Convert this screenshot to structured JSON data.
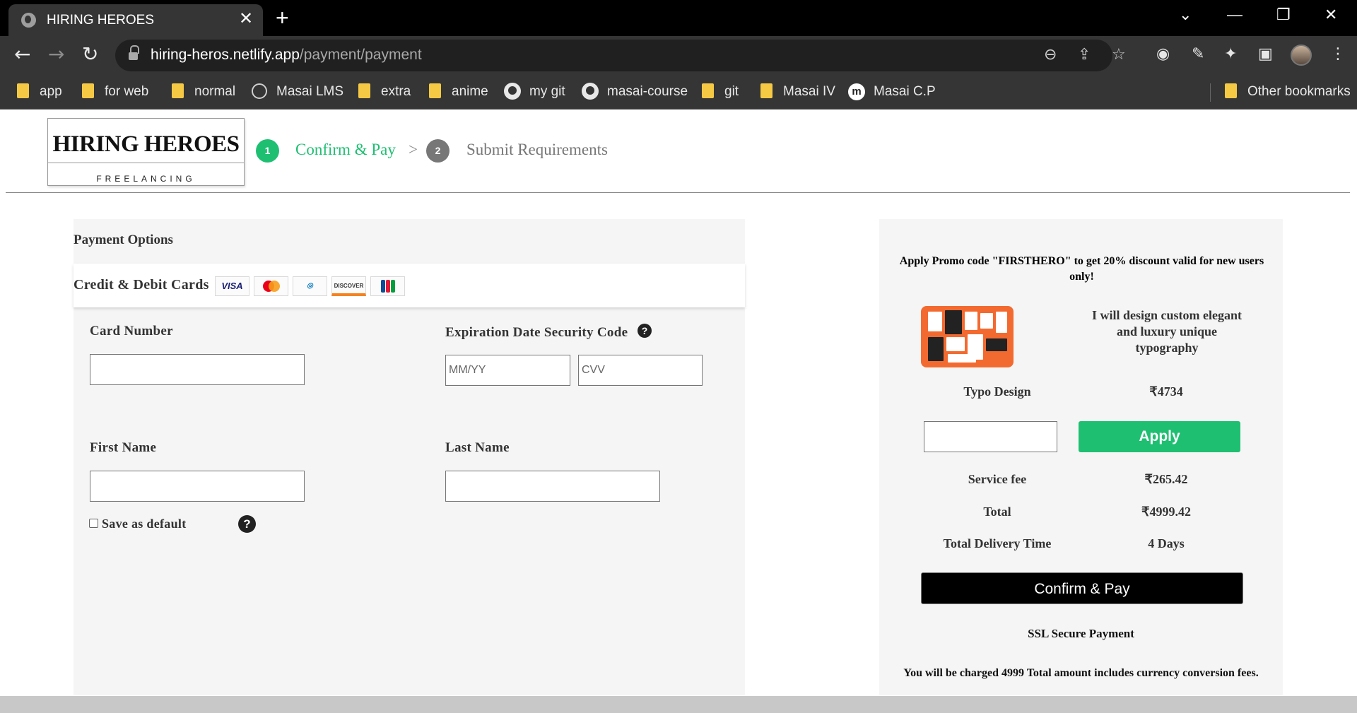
{
  "browser": {
    "tab_title": "HIRING HEROES",
    "url_host": "hiring-heros.netlify.app",
    "url_path": "/payment/payment",
    "bookmarks": [
      {
        "label": "app",
        "icon": "folder-icon"
      },
      {
        "label": "for web",
        "icon": "folder-icon"
      },
      {
        "label": "normal",
        "icon": "folder-icon"
      },
      {
        "label": "Masai LMS",
        "icon": "globe-icon"
      },
      {
        "label": "extra",
        "icon": "folder-icon"
      },
      {
        "label": "anime",
        "icon": "folder-icon"
      },
      {
        "label": "my git",
        "icon": "github-icon"
      },
      {
        "label": "masai-course",
        "icon": "github-icon"
      },
      {
        "label": "git",
        "icon": "folder-icon"
      },
      {
        "label": "Masai IV",
        "icon": "folder-icon"
      },
      {
        "label": "Masai C.P",
        "icon": "masai-icon"
      }
    ],
    "other_bookmarks": "Other bookmarks"
  },
  "header": {
    "logo_main": "HIRING HEROES",
    "logo_sub": "FREELANCING",
    "steps": [
      {
        "number": "1",
        "label": "Confirm & Pay",
        "color": "#1fbf72"
      },
      {
        "number": "2",
        "label": "Submit Requirements",
        "color": "#777777"
      }
    ],
    "step_separator": ">"
  },
  "payment": {
    "title": "Payment Options",
    "cards_label": "Credit & Debit Cards",
    "card_brands": [
      "VISA",
      "Mastercard",
      "Diners Club",
      "DISCOVER",
      "JCB"
    ],
    "card_number_label": "Card Number",
    "expiry_label": "Expiration Date Security Code",
    "expiry_placeholder": "MM/YY",
    "cvv_placeholder": "CVV",
    "first_name_label": "First Name",
    "last_name_label": "Last Name",
    "save_default_label": "Save as default",
    "help_glyph": "?"
  },
  "summary": {
    "promo_text": "Apply Promo code \"FIRSTHERO\" to get 20% discount valid for new users only!",
    "gig_title": "I will design custom elegant and luxury unique typography",
    "item_name": "Typo Design",
    "item_price": "₹4734",
    "apply_label": "Apply",
    "service_fee_label": "Service fee",
    "service_fee_value": "₹265.42",
    "total_label": "Total",
    "total_value": "₹4999.42",
    "delivery_label": "Total Delivery Time",
    "delivery_value": "4 Days",
    "confirm_label": "Confirm & Pay",
    "ssl_text": "SSL Secure Payment",
    "charge_text": "You will be charged 4999 Total amount includes currency conversion fees.",
    "accent_color": "#1fbf72"
  }
}
